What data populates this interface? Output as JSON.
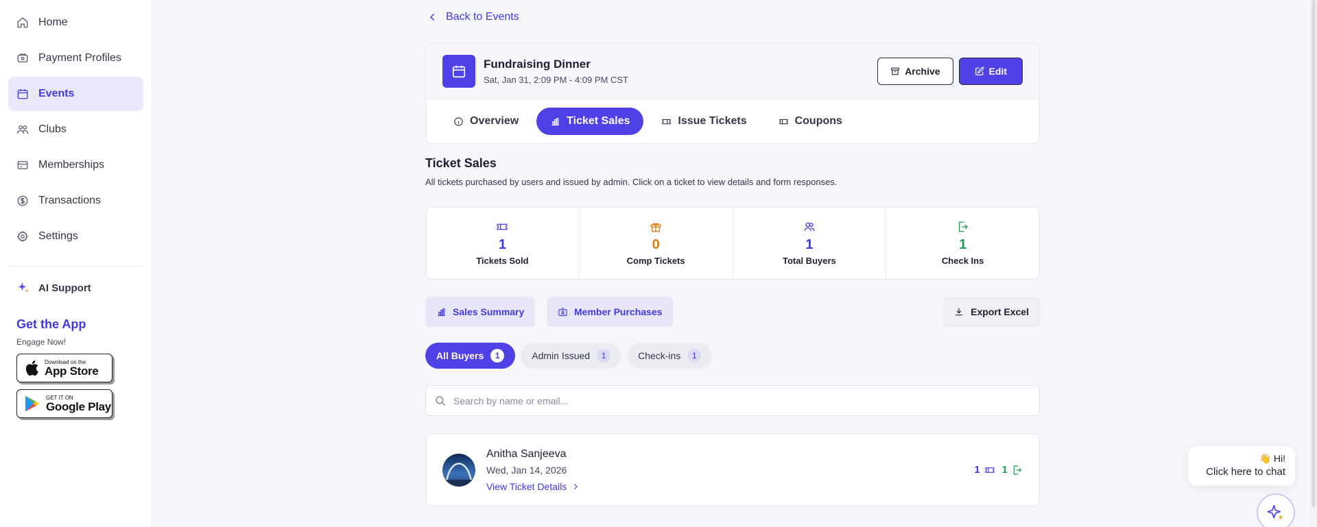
{
  "sidebar": {
    "items": [
      {
        "label": "Home",
        "icon": "home-icon"
      },
      {
        "label": "Payment Profiles",
        "icon": "wallet-icon"
      },
      {
        "label": "Events",
        "icon": "calendar-icon",
        "active": true
      },
      {
        "label": "Clubs",
        "icon": "users-icon"
      },
      {
        "label": "Memberships",
        "icon": "card-icon"
      },
      {
        "label": "Transactions",
        "icon": "dollar-icon"
      },
      {
        "label": "Settings",
        "icon": "gear-icon"
      }
    ],
    "ai_support": "AI Support",
    "get_app_title": "Get the App",
    "get_app_sub": "Engage Now!",
    "app_store": {
      "small": "Download on the",
      "big": "App Store"
    },
    "google_play": {
      "small": "GET IT ON",
      "big": "Google Play"
    }
  },
  "back_label": "Back to Events",
  "event": {
    "title": "Fundraising Dinner",
    "date": "Sat, Jan 31, 2:09 PM - 4:09 PM CST",
    "archive_label": "Archive",
    "edit_label": "Edit"
  },
  "tabs": [
    {
      "label": "Overview",
      "icon": "info-icon"
    },
    {
      "label": "Ticket Sales",
      "icon": "bar-chart-icon",
      "active": true
    },
    {
      "label": "Issue Tickets",
      "icon": "ticket-icon"
    },
    {
      "label": "Coupons",
      "icon": "coupon-icon"
    }
  ],
  "section": {
    "title": "Ticket Sales",
    "desc": "All tickets purchased by users and issued by admin. Click on a ticket to view details and form responses."
  },
  "stats": [
    {
      "value": "1",
      "label": "Tickets Sold",
      "color": "#4438e0",
      "icon": "ticket-icon"
    },
    {
      "value": "0",
      "label": "Comp Tickets",
      "color": "#e07b12",
      "icon": "gift-icon"
    },
    {
      "value": "1",
      "label": "Total Buyers",
      "color": "#4438e0",
      "icon": "buyers-icon"
    },
    {
      "value": "1",
      "label": "Check Ins",
      "color": "#1f9d55",
      "icon": "check-in-icon"
    }
  ],
  "actions": {
    "sales_summary": "Sales Summary",
    "member_purchases": "Member Purchases",
    "export_excel": "Export Excel"
  },
  "filters": [
    {
      "label": "All Buyers",
      "count": "1",
      "active": true
    },
    {
      "label": "Admin Issued",
      "count": "1"
    },
    {
      "label": "Check-ins",
      "count": "1"
    }
  ],
  "search": {
    "placeholder": "Search by name or email..."
  },
  "buyer": {
    "name": "Anitha Sanjeeva",
    "date": "Wed, Jan 14, 2026",
    "link": "View Ticket Details",
    "tickets": "1",
    "checkins": "1"
  },
  "chat": {
    "line1": "👋 Hi!",
    "line2": "Click here to chat"
  },
  "colors": {
    "accent": "#4e41e6",
    "accent_text": "#4438e0",
    "orange": "#e07b12",
    "green": "#1f9d55"
  }
}
